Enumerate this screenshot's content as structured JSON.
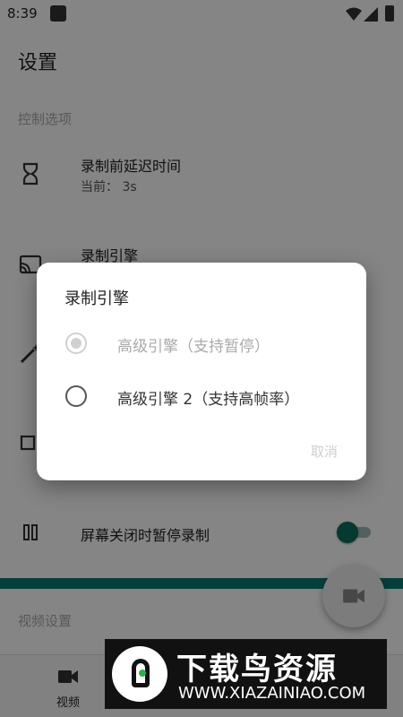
{
  "status_bar": {
    "time": "8:39"
  },
  "app_bar": {
    "title": "设置"
  },
  "sections": {
    "record_options": "控制选项",
    "video_settings": "视频设置"
  },
  "rows": {
    "delay": {
      "title": "录制前延迟时间",
      "subtitle": "当前： 3s"
    },
    "engine": {
      "title": "录制引擎"
    },
    "pause_screen_off": {
      "title": "屏幕关闭时暂停录制"
    }
  },
  "bottom_nav": {
    "video_label": "视频"
  },
  "dialog": {
    "title": "录制引擎",
    "options": [
      {
        "label": "高级引擎（支持暂停）",
        "selected": true,
        "disabled": true
      },
      {
        "label": "高级引擎 2（支持高帧率）",
        "selected": false,
        "disabled": false
      }
    ],
    "cancel_label": "取消"
  },
  "watermark": {
    "brand": "下载鸟资源",
    "url": "WWW.XIAZAINIAO.COM"
  },
  "colors": {
    "accent": "#0b7a6e",
    "thumb": "#0b6f63"
  },
  "toggle_state": "on"
}
